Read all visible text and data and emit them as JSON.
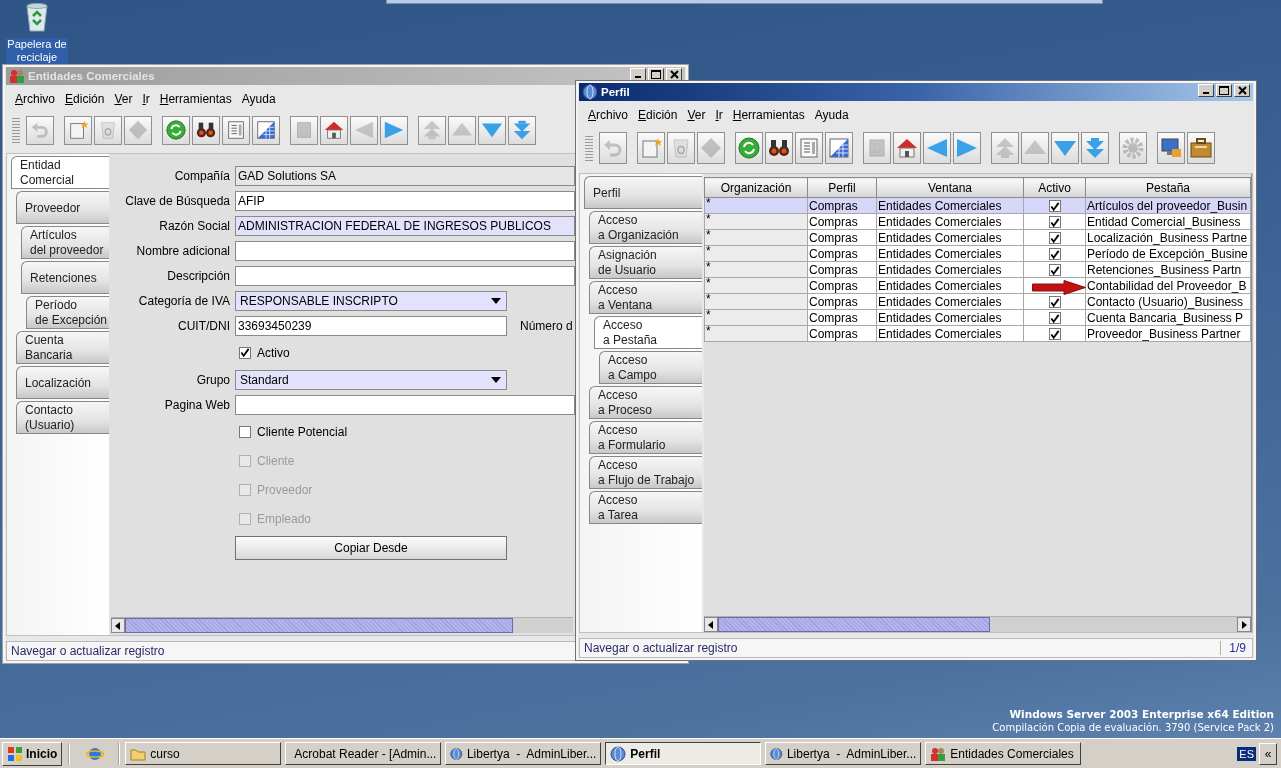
{
  "desktop": {
    "icon_label": "Papelera de reciclaje",
    "os_notice": [
      "Windows Server 2003 Enterprise x64 Edition",
      "Compilación Copia de evaluación. 3790 (Service Pack 2)"
    ]
  },
  "entidades_window": {
    "title": "Entidades Comerciales",
    "active": false,
    "menu": [
      {
        "label": "Archivo",
        "mnemonic": true
      },
      {
        "label": "Edición",
        "mnemonic": true
      },
      {
        "label": "Ver",
        "mnemonic": true
      },
      {
        "label": "Ir",
        "mnemonic": true
      },
      {
        "label": "Herramientas",
        "mnemonic": true
      },
      {
        "label": "Ayuda",
        "mnemonic": false
      }
    ],
    "toolbar": [
      [
        {
          "kind": "undo",
          "disabled": true
        }
      ],
      [
        {
          "kind": "new",
          "disabled": false
        },
        {
          "kind": "bin",
          "disabled": true
        },
        {
          "kind": "diamond",
          "disabled": true
        }
      ],
      [
        {
          "kind": "refresh",
          "disabled": false
        },
        {
          "kind": "binoculars",
          "disabled": false
        },
        {
          "kind": "report",
          "disabled": false
        },
        {
          "kind": "grid",
          "disabled": false
        }
      ],
      [
        {
          "kind": "square",
          "disabled": true
        },
        {
          "kind": "home",
          "disabled": false
        },
        {
          "kind": "back",
          "disabled": true
        },
        {
          "kind": "forward",
          "disabled": false
        }
      ],
      [
        {
          "kind": "first",
          "disabled": true
        },
        {
          "kind": "up",
          "disabled": true
        },
        {
          "kind": "down",
          "disabled": false
        },
        {
          "kind": "last",
          "disabled": false
        }
      ]
    ],
    "tabs": [
      {
        "label": "Entidad\nComercial",
        "selected": true,
        "children": [
          {
            "label": "Proveedor",
            "selected": false,
            "children": [
              {
                "label": "Artículos\ndel proveedor",
                "selected": false
              },
              {
                "label": "Retenciones",
                "selected": false,
                "children": [
                  {
                    "label": "Período\nde Excepción",
                    "selected": false
                  }
                ]
              }
            ]
          },
          {
            "label": "Cuenta\nBancaria",
            "selected": false
          },
          {
            "label": "Localización",
            "selected": false
          },
          {
            "label": "Contacto\n(Usuario)",
            "selected": false
          }
        ]
      }
    ],
    "fields": [
      {
        "kind": "text",
        "label": "Compañía",
        "value": "GAD Solutions SA",
        "readonly": true,
        "mandatory": false
      },
      {
        "kind": "text",
        "label": "Clave de Búsqueda",
        "value": "AFIP",
        "readonly": false,
        "mandatory": false
      },
      {
        "kind": "text",
        "label": "Razón Social",
        "value": "ADMINISTRACION FEDERAL DE INGRESOS PUBLICOS",
        "readonly": false,
        "mandatory": true
      },
      {
        "kind": "text",
        "label": "Nombre adicional",
        "readonly": false,
        "mandatory": false
      },
      {
        "kind": "text",
        "label": "Descripción",
        "readonly": false,
        "mandatory": false
      },
      {
        "kind": "select",
        "label": "Categoría de IVA",
        "value": "RESPONSABLE INSCRIPTO",
        "mandatory": true
      },
      {
        "kind": "text",
        "label": "CUIT/DNI",
        "value": "33693450239",
        "readonly": false,
        "mandatory": false,
        "trailing_label": "Número d"
      },
      {
        "kind": "checkbox",
        "label": "Activo",
        "checked": true,
        "disabled": false
      },
      {
        "kind": "select",
        "label": "Grupo",
        "value": "Standard",
        "mandatory": true
      },
      {
        "kind": "text",
        "label": "Pagina Web",
        "readonly": false,
        "mandatory": false
      },
      {
        "kind": "checkbox",
        "label": "Cliente Potencial",
        "checked": false,
        "disabled": false
      },
      {
        "kind": "checkbox",
        "label": "Cliente",
        "checked": false,
        "disabled": true
      },
      {
        "kind": "checkbox",
        "label": "Proveedor",
        "checked": false,
        "disabled": true
      },
      {
        "kind": "checkbox",
        "label": "Empleado",
        "checked": false,
        "disabled": true
      },
      {
        "kind": "button",
        "label": "Copiar Desde"
      }
    ],
    "status_bar": "Navegar o actualizar registro"
  },
  "perfil_window": {
    "title": "Perfil",
    "active": true,
    "menu": [
      {
        "label": "Archivo",
        "mnemonic": true
      },
      {
        "label": "Edición",
        "mnemonic": true
      },
      {
        "label": "Ver",
        "mnemonic": true
      },
      {
        "label": "Ir",
        "mnemonic": true
      },
      {
        "label": "Herramientas",
        "mnemonic": true
      },
      {
        "label": "Ayuda",
        "mnemonic": false
      }
    ],
    "toolbar": [
      [
        {
          "kind": "undo",
          "disabled": true
        }
      ],
      [
        {
          "kind": "new",
          "disabled": false
        },
        {
          "kind": "bin",
          "disabled": true
        },
        {
          "kind": "diamond",
          "disabled": true
        }
      ],
      [
        {
          "kind": "refresh",
          "disabled": false
        },
        {
          "kind": "binoculars",
          "disabled": false
        },
        {
          "kind": "report",
          "disabled": false
        },
        {
          "kind": "grid",
          "disabled": false
        }
      ],
      [
        {
          "kind": "square",
          "disabled": true
        },
        {
          "kind": "home",
          "disabled": false
        },
        {
          "kind": "back",
          "disabled": false
        },
        {
          "kind": "forward",
          "disabled": false
        }
      ],
      [
        {
          "kind": "first",
          "disabled": true
        },
        {
          "kind": "up",
          "disabled": true
        },
        {
          "kind": "down",
          "disabled": false
        },
        {
          "kind": "last",
          "disabled": false
        }
      ],
      [
        {
          "kind": "gear",
          "disabled": true
        }
      ],
      [
        {
          "kind": "monitor",
          "disabled": false
        },
        {
          "kind": "briefcase",
          "disabled": false
        }
      ]
    ],
    "tabs": [
      {
        "label": "Perfil",
        "selected": false,
        "children": [
          {
            "label": "Acceso\na Organización",
            "selected": false
          },
          {
            "label": "Asignación\nde Usuario",
            "selected": false
          },
          {
            "label": "Acceso\na Ventana",
            "selected": false,
            "children": [
              {
                "label": "Acceso\na Pestaña",
                "selected": true,
                "children": [
                  {
                    "label": "Acceso\na Campo",
                    "selected": false
                  }
                ]
              }
            ]
          },
          {
            "label": "Acceso\na Proceso",
            "selected": false
          },
          {
            "label": "Acceso\na Formulario",
            "selected": false
          },
          {
            "label": "Acceso\na Flujo de Trabajo",
            "selected": false
          },
          {
            "label": "Acceso\na Tarea",
            "selected": false
          }
        ]
      }
    ],
    "table": {
      "columns": [
        "Organización",
        "Perfil",
        "Ventana",
        "Activo",
        "Pestaña"
      ],
      "rows": [
        {
          "selected": true,
          "organizacion": "*",
          "perfil": "Compras",
          "ventana": "Entidades Comerciales",
          "activo": true,
          "pestana": "Artículos del proveedor_Busin"
        },
        {
          "selected": false,
          "organizacion": "*",
          "perfil": "Compras",
          "ventana": "Entidades Comerciales",
          "activo": true,
          "pestana": "Entidad Comercial_Business"
        },
        {
          "selected": false,
          "organizacion": "*",
          "perfil": "Compras",
          "ventana": "Entidades Comerciales",
          "activo": true,
          "pestana": "Localización_Business Partne"
        },
        {
          "selected": false,
          "organizacion": "*",
          "perfil": "Compras",
          "ventana": "Entidades Comerciales",
          "activo": true,
          "pestana": "Período de Excepción_Busine"
        },
        {
          "selected": false,
          "organizacion": "*",
          "perfil": "Compras",
          "ventana": "Entidades Comerciales",
          "activo": true,
          "pestana": "Retenciones_Business Partn"
        },
        {
          "selected": false,
          "organizacion": "*",
          "perfil": "Compras",
          "ventana": "Entidades Comerciales",
          "pestana": "Contabilidad del Proveedor_B"
        },
        {
          "selected": false,
          "organizacion": "*",
          "perfil": "Compras",
          "ventana": "Entidades Comerciales",
          "activo": true,
          "pestana": "Contacto (Usuario)_Business"
        },
        {
          "selected": false,
          "organizacion": "*",
          "perfil": "Compras",
          "ventana": "Entidades Comerciales",
          "activo": true,
          "pestana": "Cuenta Bancaria_Business P"
        },
        {
          "selected": false,
          "organizacion": "*",
          "perfil": "Compras",
          "ventana": "Entidades Comerciales",
          "activo": true,
          "pestana": "Proveedor_Business Partner"
        }
      ]
    },
    "status_bar": "Navegar o actualizar registro",
    "record_count": "1/9"
  },
  "taskbar": {
    "start": "Inicio",
    "tasks": [
      {
        "kind": "folder",
        "label": "curso",
        "selected": false
      },
      {
        "kind": "pdf",
        "label": "Acrobat Reader - [Admin...",
        "selected": false
      },
      {
        "kind": "globe",
        "label": "Libertya  -  AdminLiber...",
        "selected": false
      },
      {
        "kind": "globe",
        "label": "Perfil",
        "selected": true
      },
      {
        "kind": "globe",
        "label": "Libertya  -  AdminLiber...",
        "selected": false
      },
      {
        "kind": "people",
        "label": "Entidades Comerciales",
        "selected": false
      }
    ],
    "language": "ES",
    "tray_toggle": "«"
  }
}
